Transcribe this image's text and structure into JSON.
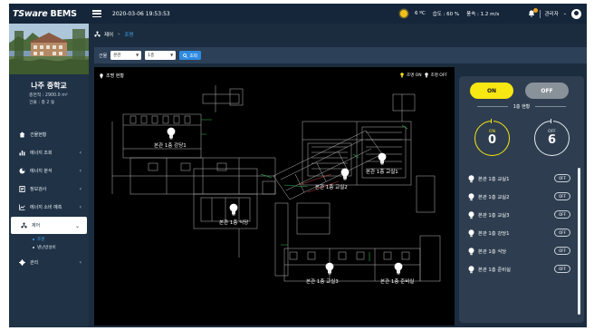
{
  "app": {
    "brand_italic": "TSware",
    "brand_rest": " BEMS",
    "datetime": "2020-03-06 19:53:53"
  },
  "weather": {
    "temp": "6 ºC",
    "humidity": "습도 : 60 %",
    "wind": "풍속 : 1.2 m/s"
  },
  "user": {
    "label": "관리자",
    "notification_icon": "bell-icon",
    "avatar_icon": "user-icon"
  },
  "school": {
    "name": "나주 중학교",
    "area": "총면적 : 2900.0 m²",
    "floors": "건물 : 총 2 동"
  },
  "sidebar": {
    "items": [
      {
        "label": "건물현황",
        "icon": "home-icon",
        "chevron": ""
      },
      {
        "label": "에너지 조회",
        "icon": "bar-chart-icon",
        "chevron": "‹"
      },
      {
        "label": "에너지 분석",
        "icon": "pie-chart-icon",
        "chevron": "‹"
      },
      {
        "label": "정보검사",
        "icon": "report-icon",
        "chevron": "‹"
      },
      {
        "label": "에너지 소비 예측",
        "icon": "line-chart-icon",
        "chevron": "‹"
      },
      {
        "label": "제어",
        "icon": "control-icon",
        "chevron": "⌄"
      },
      {
        "label": "관리",
        "icon": "gear-icon",
        "chevron": "‹"
      }
    ],
    "subitems": [
      {
        "label": "조명"
      },
      {
        "label": "냉난방설비"
      }
    ]
  },
  "breadcrumb": {
    "parent": "제어",
    "separator": "›",
    "current": "조명"
  },
  "filter": {
    "building_label": "건물",
    "building_value": "본관",
    "floor_value": "1층",
    "search_label": "조회"
  },
  "map": {
    "title": "조명 현황",
    "legend_on": "조명 ON",
    "legend_off": "조명 OFF",
    "rooms": [
      "본관 1층 강당1",
      "본관 1층 교실1",
      "본관 1층 교실2",
      "본관 1층 식당",
      "본관 1층 교실3",
      "본관 1층 준비실"
    ]
  },
  "control": {
    "on_label": "ON",
    "off_label": "OFF",
    "floor_title": "1층 현황",
    "on_count": "0",
    "off_count": "6",
    "rooms": [
      {
        "name": "본관 1층 교실1",
        "status": "OFF"
      },
      {
        "name": "본관 1층 교실2",
        "status": "OFF"
      },
      {
        "name": "본관 1층 교실3",
        "status": "OFF"
      },
      {
        "name": "본관 1층 강당1",
        "status": "OFF"
      },
      {
        "name": "본관 1층 식당",
        "status": "OFF"
      },
      {
        "name": "본관 1층 준비실",
        "status": "OFF"
      }
    ]
  },
  "colors": {
    "accent": "#41a6f0",
    "on_yellow": "#f7e712",
    "panel_bg": "#1b2c3e"
  }
}
